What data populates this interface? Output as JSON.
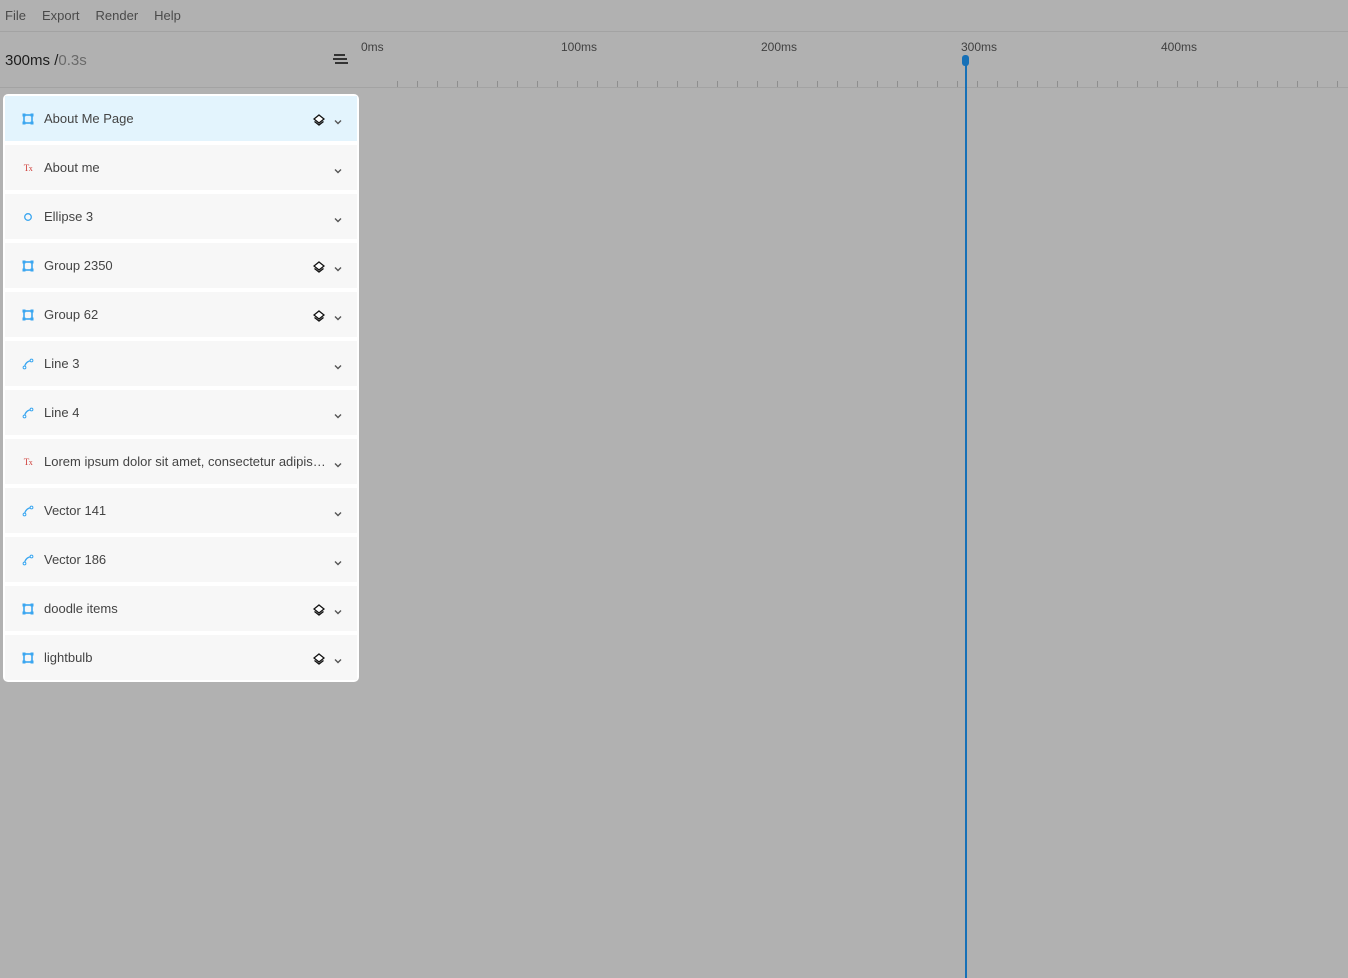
{
  "menu": [
    {
      "label": "File"
    },
    {
      "label": "Export"
    },
    {
      "label": "Render"
    },
    {
      "label": "Help"
    }
  ],
  "time": {
    "current": "300ms /",
    "total": "0.3s"
  },
  "timeline": {
    "ruler_labels": [
      {
        "label": "0ms",
        "ms": 0
      },
      {
        "label": "100ms",
        "ms": 100
      },
      {
        "label": "200ms",
        "ms": 200
      },
      {
        "label": "300ms",
        "ms": 300
      },
      {
        "label": "400ms",
        "ms": 400
      }
    ],
    "tick_interval_ms": 10,
    "playhead_ms": 300,
    "playhead_color": "#1670b7"
  },
  "layers": [
    {
      "label": "About Me Page",
      "type": "frame",
      "has_layers": true,
      "selected": true
    },
    {
      "label": "About me",
      "type": "text",
      "has_layers": false
    },
    {
      "label": "Ellipse 3",
      "type": "ellipse",
      "has_layers": false
    },
    {
      "label": "Group 2350",
      "type": "frame",
      "has_layers": true
    },
    {
      "label": "Group 62",
      "type": "frame",
      "has_layers": true
    },
    {
      "label": "Line 3",
      "type": "path",
      "has_layers": false
    },
    {
      "label": "Line 4",
      "type": "path",
      "has_layers": false
    },
    {
      "label": "Lorem ipsum dolor sit amet, consectetur adipiscing elit",
      "type": "text",
      "has_layers": false
    },
    {
      "label": "Vector 141",
      "type": "path",
      "has_layers": false
    },
    {
      "label": "Vector 186",
      "type": "path",
      "has_layers": false
    },
    {
      "label": "doodle items",
      "type": "frame",
      "has_layers": true
    },
    {
      "label": "lightbulb",
      "type": "frame",
      "has_layers": true
    }
  ],
  "colors": {
    "frame_icon": "#3aa6f0",
    "text_icon": "#d0413c",
    "selected_row": "#e3f4fd"
  }
}
